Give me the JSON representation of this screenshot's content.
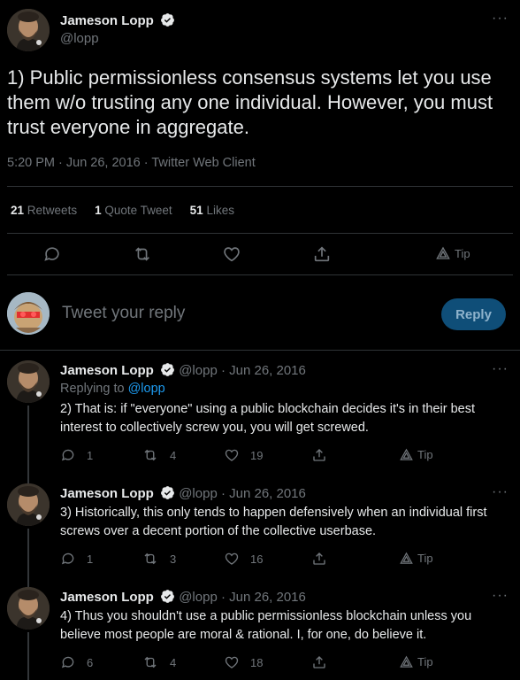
{
  "main_tweet": {
    "author_name": "Jameson Lopp",
    "handle": "@lopp",
    "text": "1) Public permissionless consensus systems let you use them w/o trusting any one individual. However, you must trust everyone in aggregate.",
    "timestamp": "5:20 PM · Jun 26, 2016 · Twitter Web Client",
    "stats": {
      "retweets_count": "21",
      "retweets_label": "Retweets",
      "quotes_count": "1",
      "quotes_label": "Quote Tweet",
      "likes_count": "51",
      "likes_label": "Likes"
    },
    "tip_label": "Tip"
  },
  "composer": {
    "placeholder": "Tweet your reply",
    "button_label": "Reply"
  },
  "replies": [
    {
      "author_name": "Jameson Lopp",
      "meta": "@lopp · Jun 26, 2016",
      "replying_prefix": "Replying to ",
      "replying_handle": "@lopp",
      "text": "2) That is: if \"everyone\" using a public blockchain decides it's in their best interest to collectively screw you, you will get screwed.",
      "replies": "1",
      "retweets": "4",
      "likes": "19",
      "tip": "Tip"
    },
    {
      "author_name": "Jameson Lopp",
      "meta": "@lopp · Jun 26, 2016",
      "text": "3) Historically, this only tends to happen defensively when an individual first screws over a decent portion of the collective userbase.",
      "replies": "1",
      "retweets": "3",
      "likes": "16",
      "tip": "Tip"
    },
    {
      "author_name": "Jameson Lopp",
      "meta": "@lopp · Jun 26, 2016",
      "text": "4) Thus you shouldn't use a public permissionless blockchain unless you believe most people are moral & rational. I, for one, do believe it.",
      "replies": "6",
      "retweets": "4",
      "likes": "18",
      "tip": "Tip"
    }
  ],
  "colors": {
    "background": "#000000",
    "text": "#e7e9ea",
    "muted": "#71767b",
    "link": "#1d9bf0",
    "reply_button": "#0f4e78",
    "divider": "#2f3336"
  },
  "icons": [
    "verified-icon",
    "more-icon",
    "reply-icon",
    "retweet-icon",
    "like-icon",
    "share-icon",
    "tip-icon"
  ]
}
